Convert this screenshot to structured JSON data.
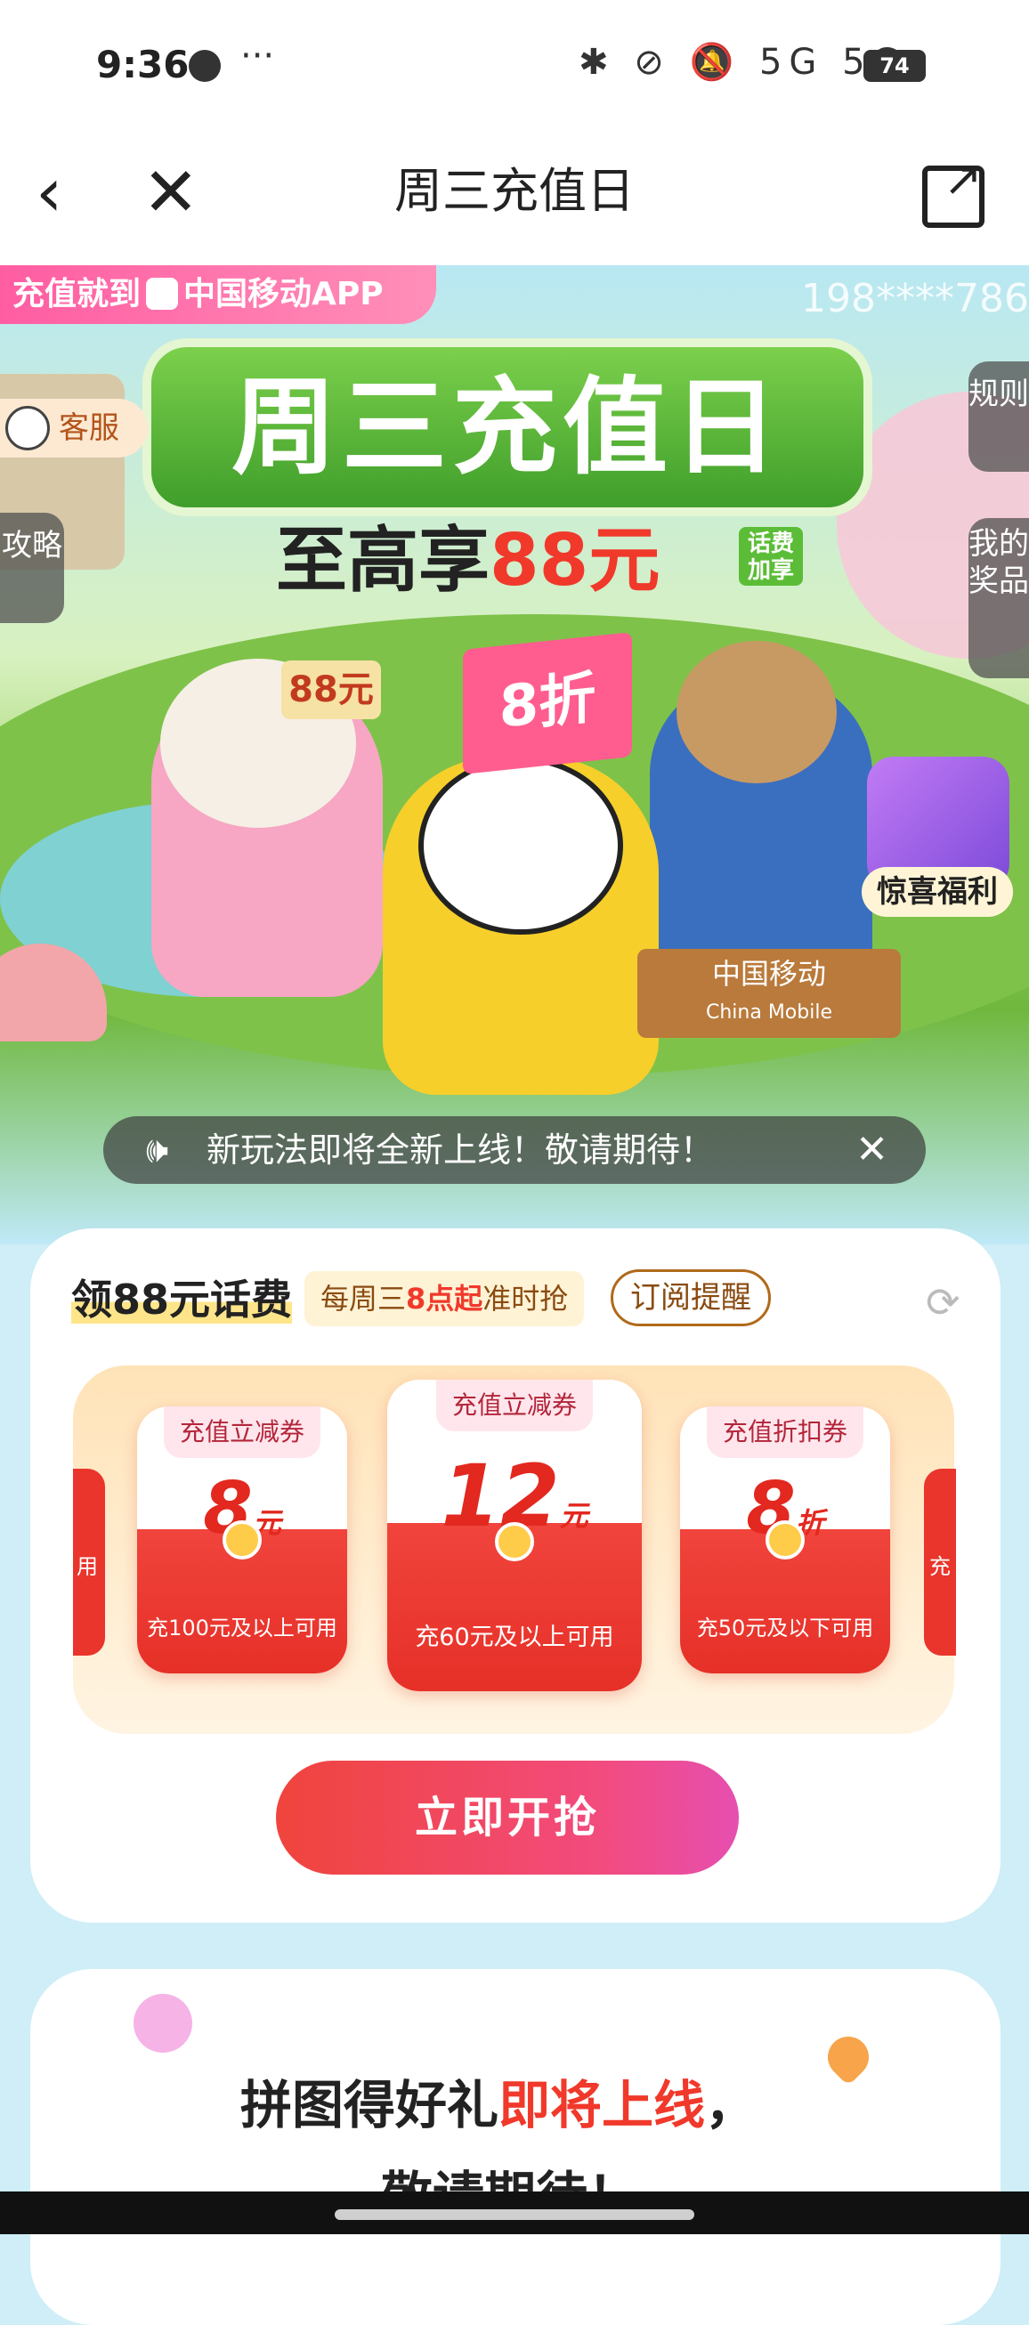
{
  "status_bar": {
    "time": "9:36",
    "more": "···",
    "icons": "✱ ⊘ 🔕 5G 5G",
    "battery": "74"
  },
  "nav": {
    "back": "‹",
    "close": "✕",
    "title": "周三充值日",
    "share": "↗"
  },
  "hero": {
    "top_tag": "充值就到",
    "top_tag_app": "中国移动APP",
    "phone": "198****786",
    "headline": "周三充值日",
    "subhead_prefix": "至高享",
    "subhead_amount": "88元",
    "huafei_tag": "话费加享",
    "kefu": "客服",
    "gonglue": "攻略",
    "guize": "规则",
    "my_prize": "我的奖品",
    "bird_card": "88元",
    "flag_text": "8折",
    "sign_cn": "中国移动",
    "sign_en": "China Mobile",
    "gift_label": "惊喜福利",
    "notice_icon": "🕪",
    "notice_text": "新玩法即将全新上线！敬请期待！",
    "notice_close": "✕"
  },
  "card1": {
    "title": "领88元话费",
    "time_prefix": "每周三",
    "time_highlight": "8点起",
    "time_suffix": "准时抢",
    "subscribe": "订阅提醒",
    "refresh_icon": "⟳",
    "side_left": "用",
    "side_right": "充",
    "coupons": [
      {
        "label": "充值立减券",
        "value": "8",
        "unit": "元",
        "condition": "充100元及以上可用"
      },
      {
        "label": "充值立减券",
        "value": "12",
        "unit": "元",
        "condition": "充60元及以上可用"
      },
      {
        "label": "充值折扣券",
        "value": "8",
        "unit": "折",
        "condition": "充50元及以下可用"
      }
    ],
    "grab_button": "立即开抢"
  },
  "card2": {
    "line1_black": "拼图得好礼",
    "line1_red": "即将上线",
    "line1_end": "，",
    "line2": "敬请期待！"
  },
  "colors": {
    "accent_red": "#f0392b",
    "accent_pink": "#e64fb0",
    "brand_green": "#5bbd37"
  }
}
